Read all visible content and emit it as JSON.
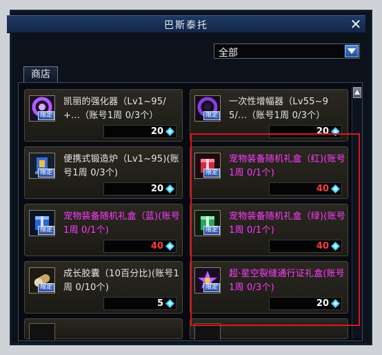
{
  "window": {
    "title": "巴斯泰托"
  },
  "filter": {
    "selected": "全部"
  },
  "tabs": [
    {
      "label": "商店"
    }
  ],
  "colors": {
    "name_white": "#e6e6e6",
    "name_magenta": "#ff3cff",
    "price_white": "#ffffff",
    "price_red": "#ff3b3b",
    "highlight": "#e3141b"
  },
  "items": [
    {
      "name": "凯丽的强化器（Lv1~95/+...（账号1周 0/3个）",
      "badge": "限定",
      "price": "20",
      "icon": "purple-orb-icon",
      "name_color": "white",
      "price_color": "white"
    },
    {
      "name": "一次性增幅器（Lv55~95/...（账号1周 0/3个）",
      "badge": "限定",
      "price": "20",
      "icon": "dark-orb-icon",
      "name_color": "white",
      "price_color": "white"
    },
    {
      "name": "便携式锻造炉（Lv1~95)(账号1周 0/3个)",
      "badge": "限定",
      "price": "20",
      "icon": "forge-icon",
      "name_color": "white",
      "price_color": "white"
    },
    {
      "name": "宠物装备随机礼盒（红)(账号1周 0/1个)",
      "badge": "限定",
      "price": "40",
      "icon": "red-giftbox-icon",
      "name_color": "magenta",
      "price_color": "red"
    },
    {
      "name": "宠物装备随机礼盒（蓝)(账号1周 0/1个)",
      "badge": "限定",
      "price": "40",
      "icon": "blue-giftbox-icon",
      "name_color": "magenta",
      "price_color": "red"
    },
    {
      "name": "宠物装备随机礼盒（绿)(账号1周 0/1个)",
      "badge": "限定",
      "price": "40",
      "icon": "green-giftbox-icon",
      "name_color": "magenta",
      "price_color": "red"
    },
    {
      "name": "成长胶囊（10百分比)(账号1周 0/10个)",
      "badge": "限定",
      "price": "5",
      "icon": "capsule-icon",
      "name_color": "white",
      "price_color": "white"
    },
    {
      "name": "超·星空裂缝通行证礼盒(账号1周 0/3个)",
      "badge": "限定",
      "price": "20",
      "icon": "star-pass-icon",
      "name_color": "magenta",
      "price_color": "white"
    }
  ]
}
